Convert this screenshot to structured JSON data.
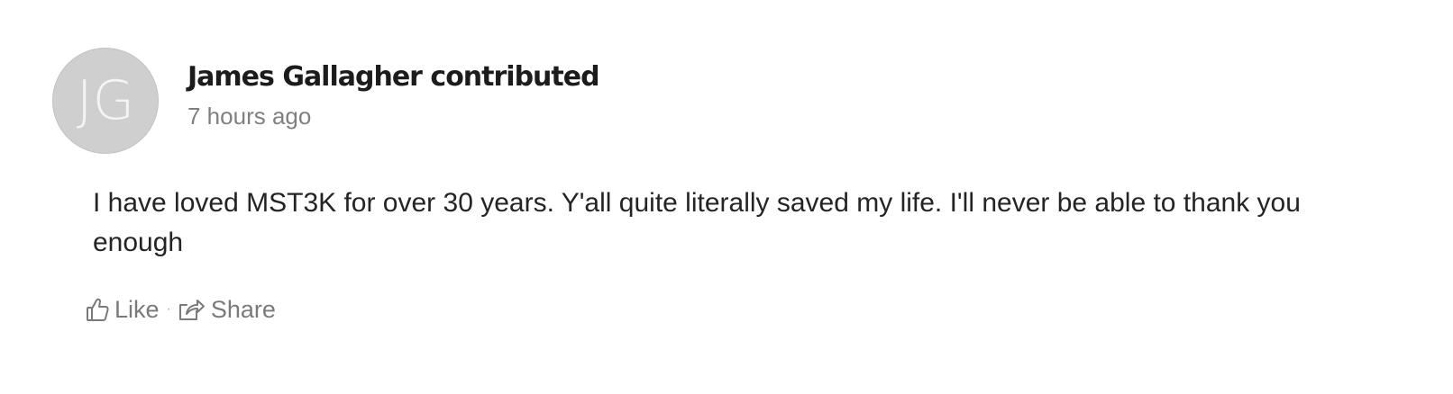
{
  "post": {
    "avatar_initials": "JG",
    "author_line": "James Gallagher contributed",
    "timestamp": "7 hours ago",
    "body": "I have loved MST3K for over 30 years. Y'all quite literally saved my life. I'll never be able to thank you enough",
    "actions": {
      "like_label": "Like",
      "separator": "·",
      "share_label": "Share"
    }
  },
  "icons": {
    "like": "thumbs-up-icon",
    "share": "share-icon"
  },
  "colors": {
    "avatar_bg": "#cfcfcf",
    "author_text": "#1c1c1c",
    "muted_text": "#808080",
    "body_text": "#242424"
  }
}
